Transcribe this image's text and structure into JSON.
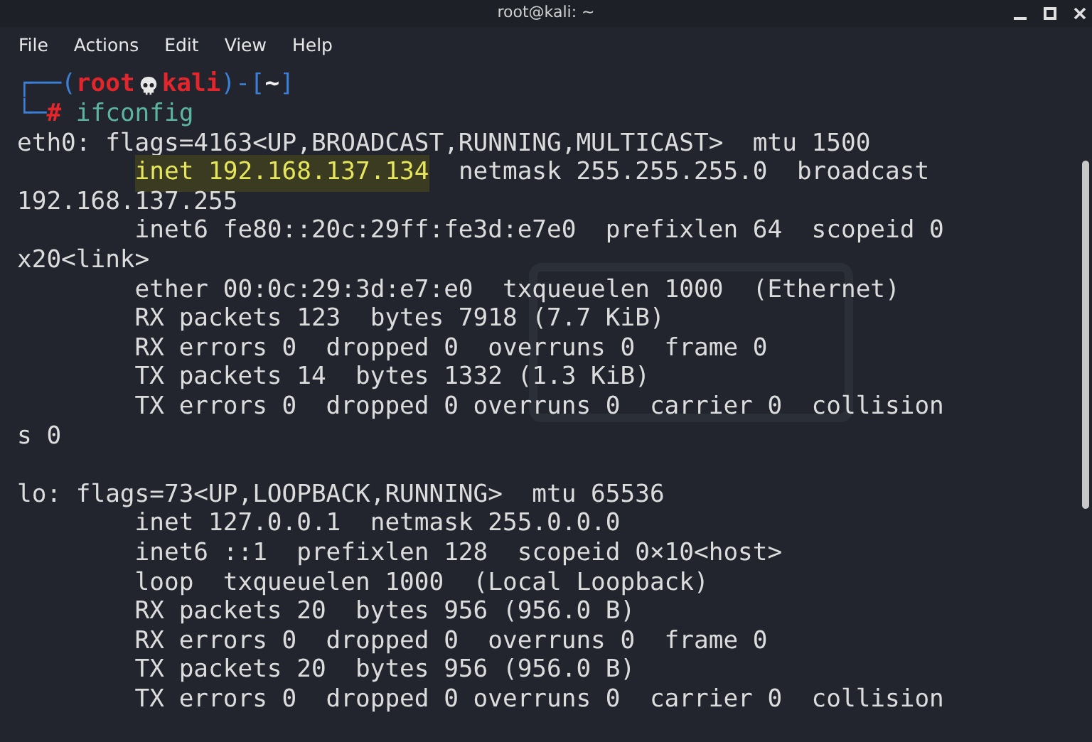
{
  "window": {
    "title": "root@kali: ~"
  },
  "menu": [
    "File",
    "Actions",
    "Edit",
    "View",
    "Help"
  ],
  "prompt": {
    "open": "┌──(",
    "user": "root",
    "host": "kali",
    "mid": ")-[",
    "path": "~",
    "close": "]",
    "corner": "└─",
    "symbol": "#",
    "command": "ifconfig"
  },
  "lines": [
    {
      "kind": "output",
      "text": "eth0: flags=4163<UP,BROADCAST,RUNNING,MULTICAST>  mtu 1500"
    },
    {
      "kind": "highlighted",
      "highlight": "inet 192.168.137.134",
      "text": "  netmask 255.255.255.0  broadcast"
    },
    {
      "kind": "output",
      "text": "192.168.137.255"
    },
    {
      "kind": "indented",
      "text": "inet6 fe80::20c:29ff:fe3d:e7e0  prefixlen 64  scopeid 0"
    },
    {
      "kind": "output",
      "text": "x20<link>"
    },
    {
      "kind": "indented",
      "text": "ether 00:0c:29:3d:e7:e0  txqueuelen 1000  (Ethernet)"
    },
    {
      "kind": "indented",
      "text": "RX packets 123  bytes 7918 (7.7 KiB)"
    },
    {
      "kind": "indented",
      "text": "RX errors 0  dropped 0  overruns 0  frame 0"
    },
    {
      "kind": "indented",
      "text": "TX packets 14  bytes 1332 (1.3 KiB)"
    },
    {
      "kind": "indented",
      "text": "TX errors 0  dropped 0 overruns 0  carrier 0  collision"
    },
    {
      "kind": "output",
      "text": "s 0"
    },
    {
      "kind": "blank"
    },
    {
      "kind": "output",
      "text": "lo: flags=73<UP,LOOPBACK,RUNNING>  mtu 65536"
    },
    {
      "kind": "indented",
      "text": "inet 127.0.0.1  netmask 255.0.0.0"
    },
    {
      "kind": "indented",
      "text": "inet6 ::1  prefixlen 128  scopeid 0×10<host>"
    },
    {
      "kind": "indented",
      "text": "loop  txqueuelen 1000  (Local Loopback)"
    },
    {
      "kind": "indented",
      "text": "RX packets 20  bytes 956 (956.0 B)"
    },
    {
      "kind": "indented",
      "text": "RX errors 0  dropped 0  overruns 0  frame 0"
    },
    {
      "kind": "indented",
      "text": "TX packets 20  bytes 956 (956.0 B)"
    },
    {
      "kind": "indented",
      "text": "TX errors 0  dropped 0 overruns 0  carrier 0  collision"
    }
  ]
}
